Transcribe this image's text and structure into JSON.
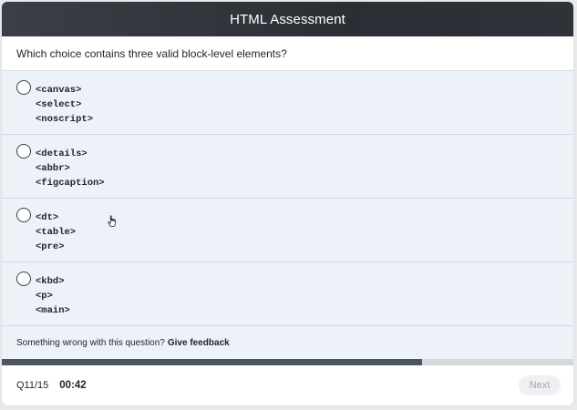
{
  "header": {
    "title": "HTML Assessment"
  },
  "question": {
    "text": "Which choice contains three valid block-level elements?"
  },
  "options": [
    {
      "lines": [
        "<canvas>",
        "<select>",
        "<noscript>"
      ]
    },
    {
      "lines": [
        "<details>",
        "<abbr>",
        "<figcaption>"
      ]
    },
    {
      "lines": [
        "<dt>",
        "<table>",
        "<pre>"
      ]
    },
    {
      "lines": [
        "<kbd>",
        "<p>",
        "<main>"
      ]
    }
  ],
  "feedback": {
    "prompt": "Something wrong with this question?",
    "link": "Give feedback"
  },
  "progress": {
    "fraction": 0.735
  },
  "footer": {
    "question_counter": "Q11/15",
    "timer": "00:42",
    "next_label": "Next"
  },
  "colors": {
    "header_bg": "#2b2f35",
    "options_bg": "#edf1f8",
    "progress_fill": "#4c5564",
    "progress_track": "#d5d7db"
  }
}
